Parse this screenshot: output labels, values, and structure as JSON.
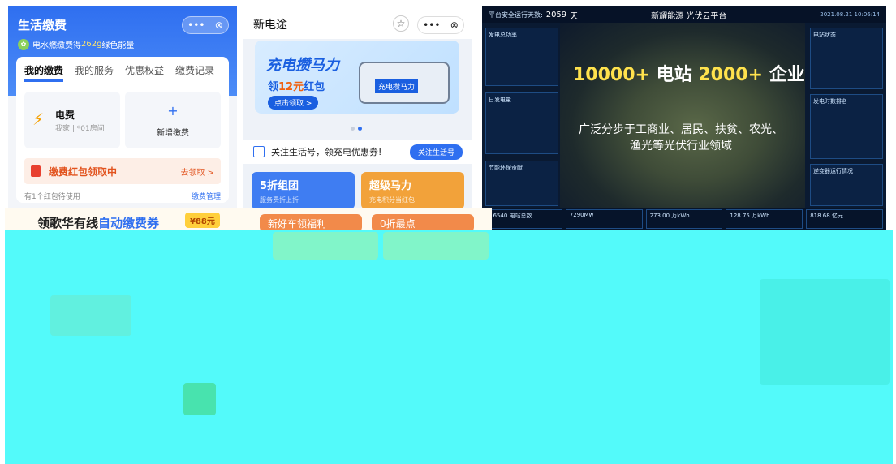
{
  "panel1": {
    "title": "生活缴费",
    "energy_prefix": "电水燃缴费得",
    "energy_value": "262g",
    "energy_suffix": "绿色能量",
    "tabs": [
      "我的缴费",
      "我的服务",
      "优惠权益",
      "缴费记录"
    ],
    "electric_title": "电费",
    "electric_sub": "我家 | *01房间",
    "new_pay_label": "新增缴费",
    "redbag_text": "缴费红包领取中",
    "redbag_action": "去领取 >",
    "footer_left": "有1个红包待使用",
    "footer_right": "缴费管理"
  },
  "panel2": {
    "title": "新电途",
    "banner_title": "充电攒马力",
    "banner_sub_prefix": "领",
    "banner_sub_highlight": "12元",
    "banner_sub_suffix": "红包",
    "banner_button": "点击领取 >",
    "jeep_label": "充电攒马力",
    "follow_text": "关注生活号，领充电优惠券!",
    "follow_button": "关注生活号",
    "tiles": [
      {
        "title": "5折组团",
        "sub": "服务费折上折",
        "color": "#3f7df2"
      },
      {
        "title": "超级马力",
        "sub": "充电积分当红包",
        "color": "#f2a23a"
      }
    ],
    "bottom_chips": [
      "新好车领福利",
      "0折最点"
    ]
  },
  "panel3": {
    "days_label": "平台安全运行天数:",
    "days_value": "2059",
    "days_unit": "天",
    "brand": "新耀能源   光伏云平台",
    "datetime": "2021.08.21 10:06:14",
    "headline_a": "10000+",
    "headline_a_unit": "电站",
    "headline_b": "2000+",
    "headline_b_unit": "企业",
    "desc_line1": "广泛分步于工商业、居民、扶贫、农光、",
    "desc_line2": "渔光等光伏行业领域",
    "left_boxes": [
      "发电总功率",
      "日发电量",
      "节能环保贡献"
    ],
    "right_boxes": [
      "电站状态",
      "发电时数排名",
      "逆变器运行情况"
    ],
    "bottom_stats": [
      "16540 电站总数",
      "7290Mw",
      "273.00 万kWh",
      "128.75 万kWh",
      "818.68 亿元"
    ]
  },
  "strip": {
    "prefix": "领歌华有线",
    "highlight": "自动缴费券",
    "coupon": "¥88元"
  },
  "colors": {
    "blue": "#2f6ff0",
    "orange": "#f5a000",
    "cyan_glitch": "#53fafa",
    "dashboard_bg": "#0a1a32",
    "headline_yellow": "#ffe24d"
  }
}
